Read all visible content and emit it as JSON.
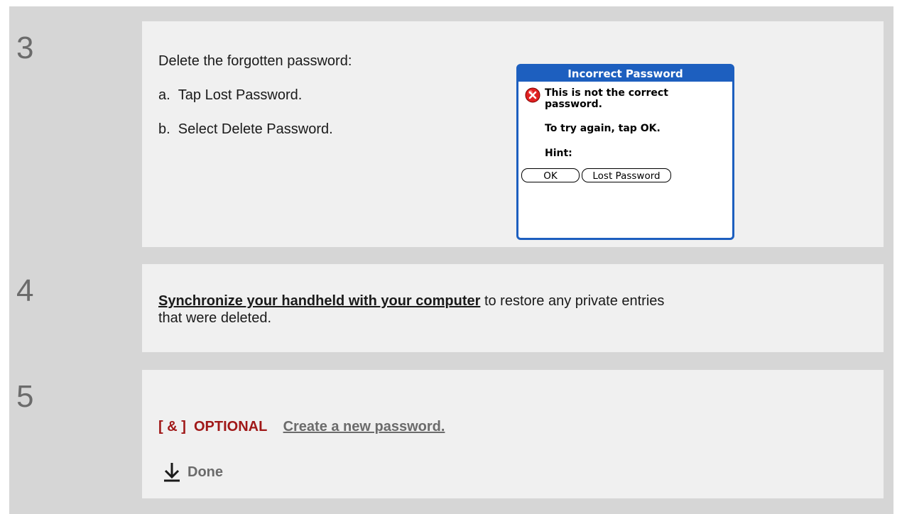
{
  "steps": [
    {
      "number": "3",
      "instruction": "Delete the forgotten password:",
      "substeps": [
        "a.  Tap Lost Password.",
        "b.  Select Delete Password."
      ]
    },
    {
      "number": "4",
      "link_text": "Synchronize your handheld with your computer",
      "text_rest": " to restore any private entries",
      "text_line2": "that were deleted."
    },
    {
      "number": "5",
      "optional_label": "[ & ]  OPTIONAL",
      "link_text": "Create a new password.",
      "done_label": "Done"
    }
  ],
  "dialog": {
    "title": "Incorrect Password",
    "message_line1": "This is not the correct",
    "message_line2": "password.",
    "retry_text": "To try again, tap OK.",
    "hint_label": "Hint:",
    "ok_button": "OK",
    "lost_password_button": "Lost Password",
    "icon": "error-x-icon"
  },
  "colors": {
    "dialog_blue": "#1d5fbf",
    "optional_red": "#a01818",
    "link_grey": "#6b6b6b"
  }
}
